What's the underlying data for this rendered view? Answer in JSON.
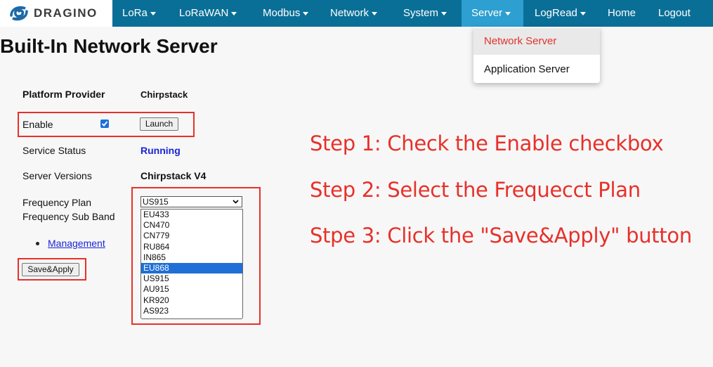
{
  "brand": {
    "logo_text": "DRAGINO",
    "logo_icon": "dragino-swirl-icon"
  },
  "nav": {
    "items": [
      {
        "label": "LoRa",
        "caret": true
      },
      {
        "label": "LoRaWAN",
        "caret": true
      },
      {
        "label": "Modbus",
        "caret": true
      },
      {
        "label": "Network",
        "caret": true
      },
      {
        "label": "System",
        "caret": true
      },
      {
        "label": "Server",
        "caret": true,
        "active": true
      },
      {
        "label": "LogRead",
        "caret": true
      },
      {
        "label": "Home",
        "caret": false
      },
      {
        "label": "Logout",
        "caret": false
      }
    ],
    "colors": {
      "bar": "#0a6f97",
      "active": "#2d9fd0"
    }
  },
  "server_menu": {
    "items": [
      {
        "label": "Network Server",
        "active": true
      },
      {
        "label": "Application Server",
        "active": false
      }
    ]
  },
  "page": {
    "title": "Built-In Network Server",
    "platform_provider_label": "Platform Provider",
    "platform_provider_value": "Chirpstack",
    "enable_label": "Enable",
    "enable_checked": true,
    "launch_button": "Launch",
    "service_status_label": "Service Status",
    "service_status_value": "Running",
    "server_versions_label": "Server Versions",
    "server_versions_value": "Chirpstack V4",
    "frequency_plan_label": "Frequency Plan",
    "frequency_plan_value": "US915",
    "frequency_sub_band_label": "Frequency Sub Band",
    "frequency_options": [
      "EU433",
      "CN470",
      "CN779",
      "RU864",
      "IN865",
      "EU868",
      "US915",
      "AU915",
      "KR920",
      "AS923"
    ],
    "highlighted_option": "EU868",
    "management_link": "Management",
    "save_apply_button": "Save&Apply"
  },
  "annotations": {
    "step1": "Step 1: Check the Enable checkbox",
    "step2": "Step 2: Select the Frequecct Plan",
    "step3": "Stpe 3: Click the \"Save&Apply\" button",
    "color": "#e8302a"
  }
}
